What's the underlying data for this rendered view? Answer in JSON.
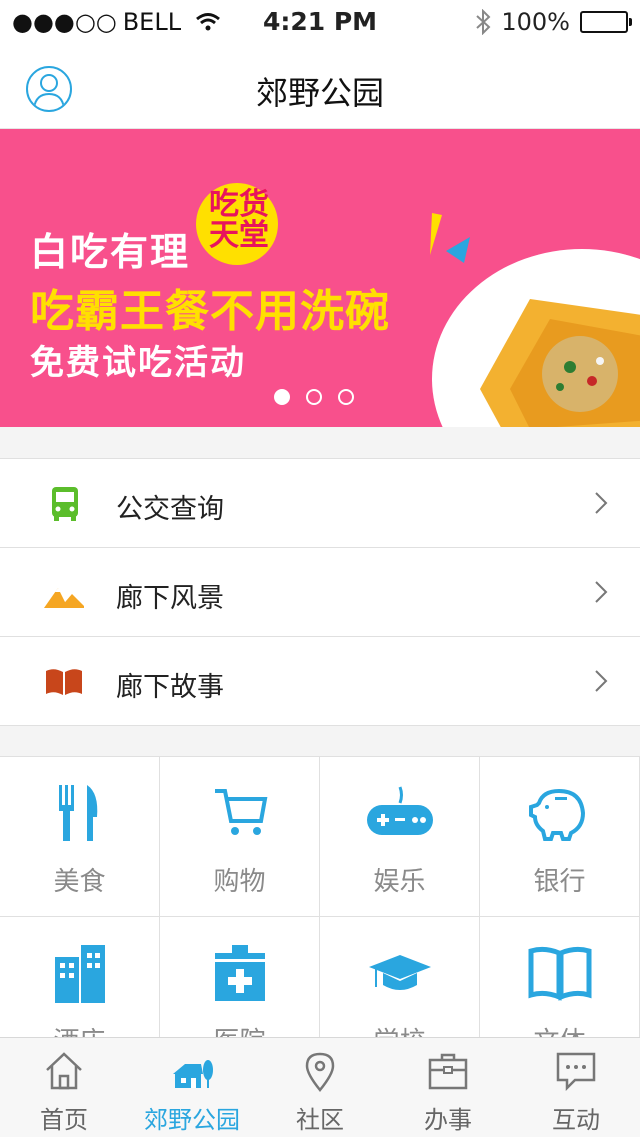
{
  "status_bar": {
    "signal": "●●●○○",
    "carrier": "BELL",
    "time": "4:21 PM",
    "battery": "100%"
  },
  "header": {
    "title": "郊野公园"
  },
  "banner": {
    "line1": "白吃有理",
    "badge": "吃货天堂",
    "line2": "吃霸王餐不用洗碗",
    "line3": "免费试吃活动",
    "slides_total": 3,
    "active_slide": 1
  },
  "list_items": [
    {
      "label": "公交查询",
      "icon": "bus-icon",
      "color": "#5bbd2b"
    },
    {
      "label": "廊下风景",
      "icon": "mountain-icon",
      "color": "#f5a623"
    },
    {
      "label": "廊下故事",
      "icon": "book-icon",
      "color": "#c8461b"
    }
  ],
  "grid": [
    {
      "label": "美食",
      "icon": "fork-knife-icon"
    },
    {
      "label": "购物",
      "icon": "cart-icon"
    },
    {
      "label": "娱乐",
      "icon": "gamepad-icon"
    },
    {
      "label": "银行",
      "icon": "piggy-bank-icon"
    },
    {
      "label": "酒店",
      "icon": "building-icon"
    },
    {
      "label": "医院",
      "icon": "medical-kit-icon"
    },
    {
      "label": "学校",
      "icon": "graduation-cap-icon"
    },
    {
      "label": "文体",
      "icon": "open-book-icon"
    }
  ],
  "tabs": [
    {
      "label": "首页",
      "icon": "home-icon",
      "active": false
    },
    {
      "label": "郊野公园",
      "icon": "park-house-icon",
      "active": true
    },
    {
      "label": "社区",
      "icon": "location-pin-icon",
      "active": false
    },
    {
      "label": "办事",
      "icon": "briefcase-icon",
      "active": false
    },
    {
      "label": "互动",
      "icon": "chat-bubble-icon",
      "active": false
    }
  ],
  "colors": {
    "accent": "#2aa6df",
    "banner_bg": "#f8508c",
    "banner_yellow": "#ffe000"
  }
}
